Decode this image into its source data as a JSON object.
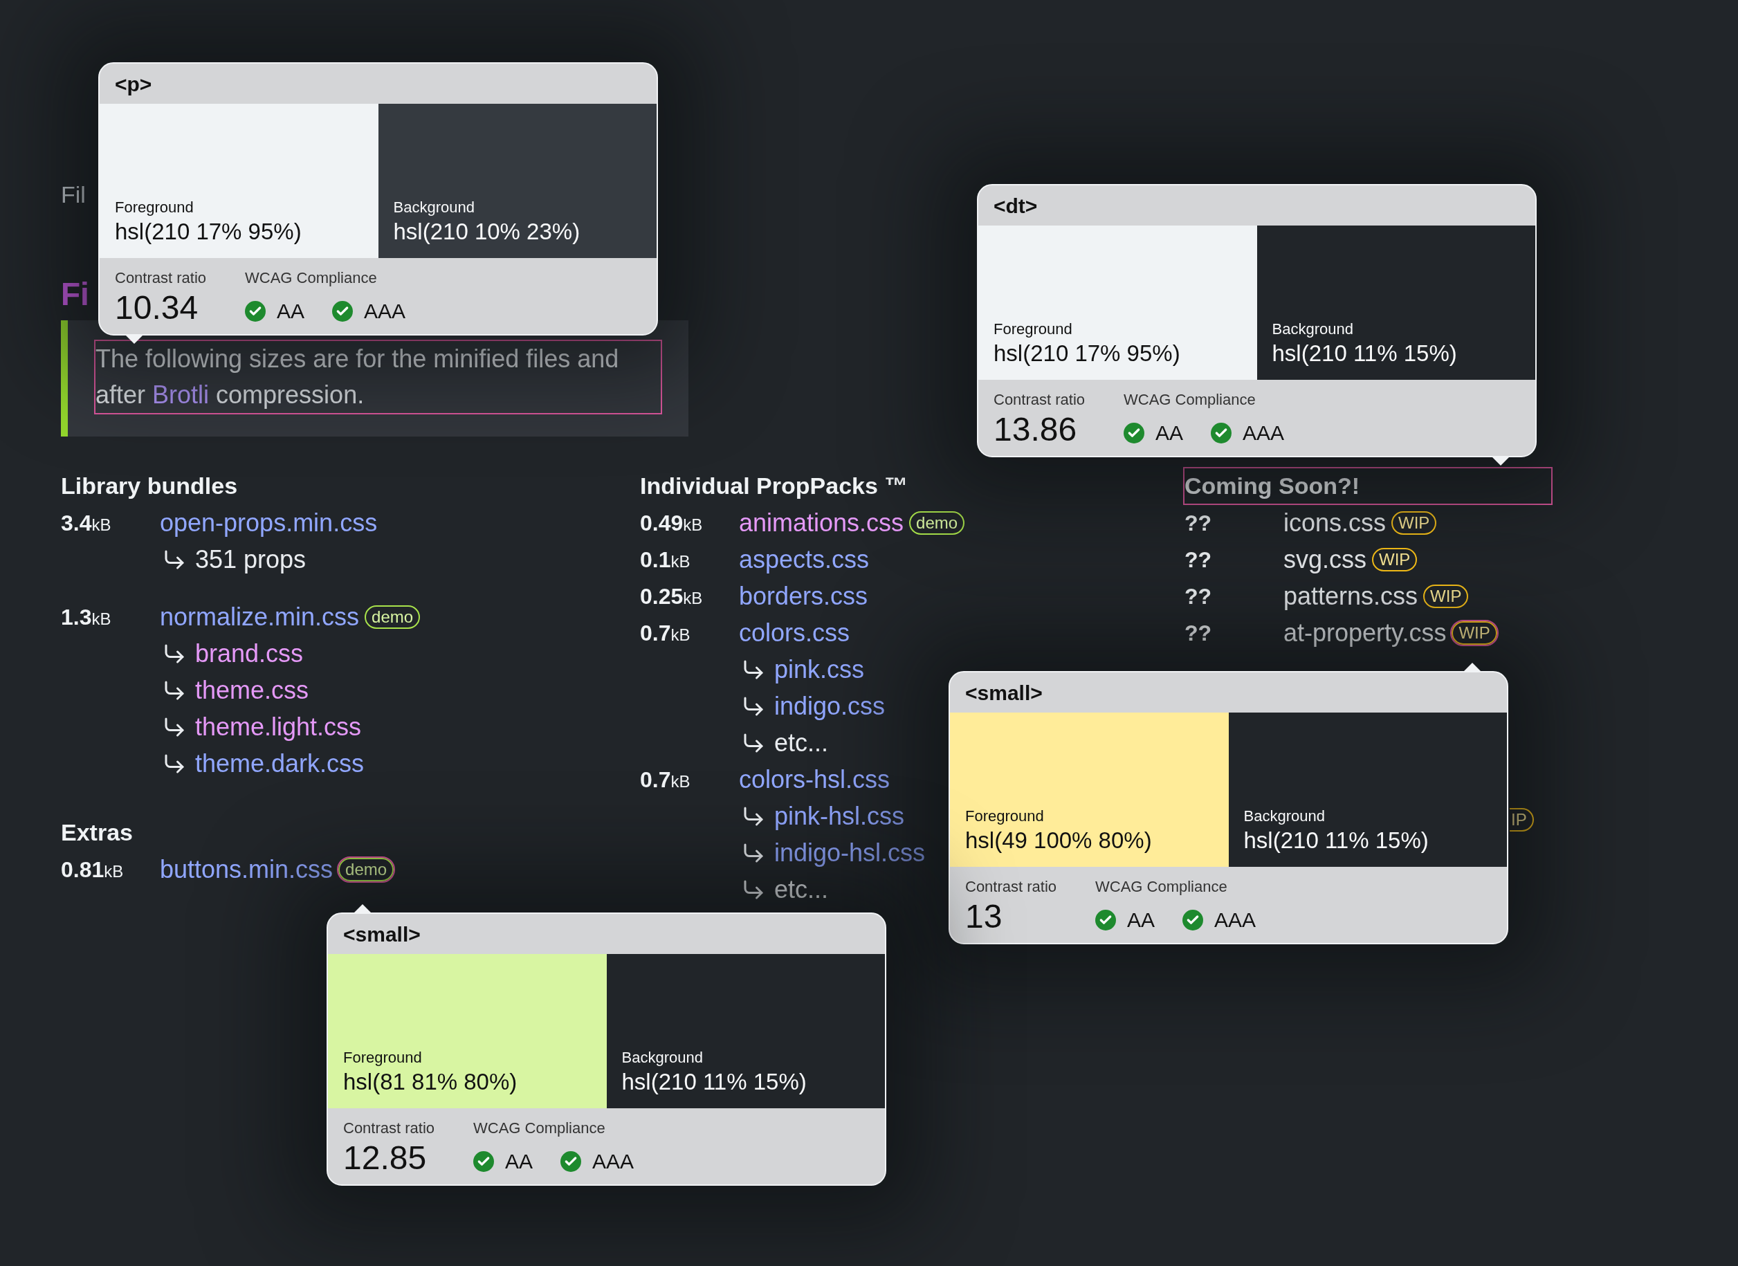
{
  "subtitle_fragment": "Fil",
  "section_heading_fragment": "Fi",
  "note": {
    "before": "The following sizes are for the minified files and after ",
    "link": "Brotli",
    "after": " compression.",
    "inspected": true
  },
  "columns": [
    {
      "sections": [
        {
          "heading": "Library bundles",
          "inspected": false,
          "entries": [
            {
              "size": "3.4",
              "unit": "kB",
              "file": "open-props.min.css",
              "visited": false,
              "subs": [
                {
                  "kind": "note",
                  "text": "351 props"
                }
              ]
            },
            {
              "size": "1.3",
              "unit": "kB",
              "file": "normalize.min.css",
              "visited": false,
              "badge": {
                "kind": "demo",
                "label": "demo",
                "inspected": false
              },
              "subs": [
                {
                  "kind": "link",
                  "text": "brand.css",
                  "visited": true
                },
                {
                  "kind": "link",
                  "text": "theme.css",
                  "visited": true
                },
                {
                  "kind": "link",
                  "text": "theme.light.css",
                  "visited": true
                },
                {
                  "kind": "link",
                  "text": "theme.dark.css",
                  "visited": false
                }
              ]
            }
          ]
        },
        {
          "heading": "Extras",
          "inspected": false,
          "entries": [
            {
              "size": "0.81",
              "unit": "kB",
              "file": "buttons.min.css",
              "visited": false,
              "badge": {
                "kind": "demo",
                "label": "demo",
                "inspected": true
              }
            }
          ]
        }
      ]
    },
    {
      "sections": [
        {
          "heading": "Individual PropPacks ™",
          "inspected": false,
          "entries": [
            {
              "size": "0.49",
              "unit": "kB",
              "file": "animations.css",
              "visited": true,
              "badge": {
                "kind": "demo",
                "label": "demo",
                "inspected": false
              }
            },
            {
              "size": "0.1",
              "unit": "kB",
              "file": "aspects.css",
              "visited": false
            },
            {
              "size": "0.25",
              "unit": "kB",
              "file": "borders.css",
              "visited": false
            },
            {
              "size": "0.7",
              "unit": "kB",
              "file": "colors.css",
              "visited": false,
              "subs": [
                {
                  "kind": "link",
                  "text": "pink.css",
                  "visited": false
                },
                {
                  "kind": "link",
                  "text": "indigo.css",
                  "visited": false
                },
                {
                  "kind": "note",
                  "text": "etc..."
                }
              ]
            },
            {
              "size": "0.7",
              "unit": "kB",
              "file": "colors-hsl.css",
              "visited": false,
              "subs": [
                {
                  "kind": "link",
                  "text": "pink-hsl.css",
                  "visited": false
                },
                {
                  "kind": "link",
                  "text": "indigo-hsl.css",
                  "visited": false
                },
                {
                  "kind": "note",
                  "text": "etc..."
                }
              ]
            }
          ]
        }
      ]
    },
    {
      "sections": [
        {
          "heading": "Coming Soon?!",
          "inspected": true,
          "entries": [
            {
              "size": "??",
              "file": "icons.css",
              "badge": {
                "kind": "wip",
                "label": "WIP",
                "inspected": false
              }
            },
            {
              "size": "??",
              "file": "svg.css",
              "badge": {
                "kind": "wip",
                "label": "WIP",
                "inspected": false
              }
            },
            {
              "size": "??",
              "file": "patterns.css",
              "badge": {
                "kind": "wip",
                "label": "WIP",
                "inspected": false
              }
            },
            {
              "size": "??",
              "file": "at-property.css",
              "badge": {
                "kind": "wip",
                "label": "WIP",
                "inspected": true
              }
            }
          ]
        }
      ]
    }
  ],
  "badge_fragment": {
    "kind": "wip",
    "label": "IP"
  },
  "popups": [
    {
      "tag": "<p>",
      "foreground": {
        "label": "Foreground",
        "value": "hsl(210 17% 95%)",
        "color": "#f0f3f5"
      },
      "background": {
        "label": "Background",
        "value": "hsl(210 10% 23%)",
        "color": "#353a40"
      },
      "ratio_label": "Contrast ratio",
      "ratio": "10.34",
      "compliance_label": "WCAG Compliance",
      "checks": [
        {
          "label": "AA",
          "pass": true
        },
        {
          "label": "AAA",
          "pass": true
        }
      ]
    },
    {
      "tag": "<dt>",
      "foreground": {
        "label": "Foreground",
        "value": "hsl(210 17% 95%)",
        "color": "#f0f3f5"
      },
      "background": {
        "label": "Background",
        "value": "hsl(210 11% 15%)",
        "color": "#212529"
      },
      "ratio_label": "Contrast ratio",
      "ratio": "13.86",
      "compliance_label": "WCAG Compliance",
      "checks": [
        {
          "label": "AA",
          "pass": true
        },
        {
          "label": "AAA",
          "pass": true
        }
      ]
    },
    {
      "tag": "<small>",
      "foreground": {
        "label": "Foreground",
        "value": "hsl(49 100% 80%)",
        "color": "#ffec99"
      },
      "background": {
        "label": "Background",
        "value": "hsl(210 11% 15%)",
        "color": "#212529"
      },
      "ratio_label": "Contrast ratio",
      "ratio": "13",
      "compliance_label": "WCAG Compliance",
      "checks": [
        {
          "label": "AA",
          "pass": true
        },
        {
          "label": "AAA",
          "pass": true
        }
      ]
    },
    {
      "tag": "<small>",
      "foreground": {
        "label": "Foreground",
        "value": "hsl(81 81% 80%)",
        "color": "#d8f5a2"
      },
      "background": {
        "label": "Background",
        "value": "hsl(210 11% 15%)",
        "color": "#212529"
      },
      "ratio_label": "Contrast ratio",
      "ratio": "12.85",
      "compliance_label": "WCAG Compliance",
      "checks": [
        {
          "label": "AA",
          "pass": true
        },
        {
          "label": "AAA",
          "pass": true
        }
      ]
    }
  ]
}
